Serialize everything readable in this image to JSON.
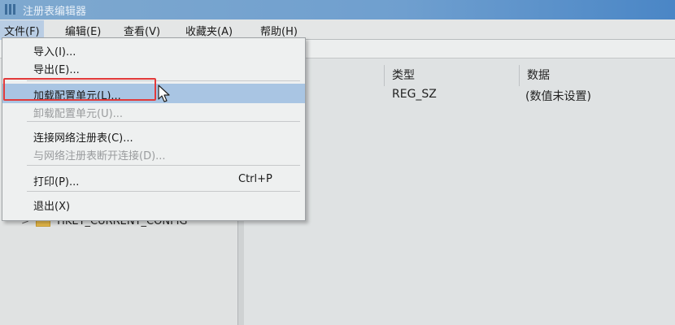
{
  "window": {
    "title": "注册表编辑器"
  },
  "menubar": {
    "items": [
      "文件(F)",
      "编辑(E)",
      "查看(V)",
      "收藏夹(A)",
      "帮助(H)"
    ]
  },
  "file_menu": {
    "import": "导入(I)...",
    "export": "导出(E)...",
    "load_hive": "加载配置单元(L)...",
    "unload_hive": "卸载配置单元(U)...",
    "connect": "连接网络注册表(C)...",
    "disconnect": "与网络注册表断开连接(D)...",
    "print": "打印(P)...",
    "print_shortcut": "Ctrl+P",
    "exit": "退出(X)"
  },
  "tree": {
    "visible_key": "HKEY_CURRENT_CONFIG"
  },
  "list": {
    "headers": {
      "type": "类型",
      "data": "数据"
    },
    "row": {
      "type": "REG_SZ",
      "data": "(数值未设置)"
    }
  },
  "colors": {
    "highlight_box": "#e23a3a",
    "selection": "#a9c5e3"
  }
}
